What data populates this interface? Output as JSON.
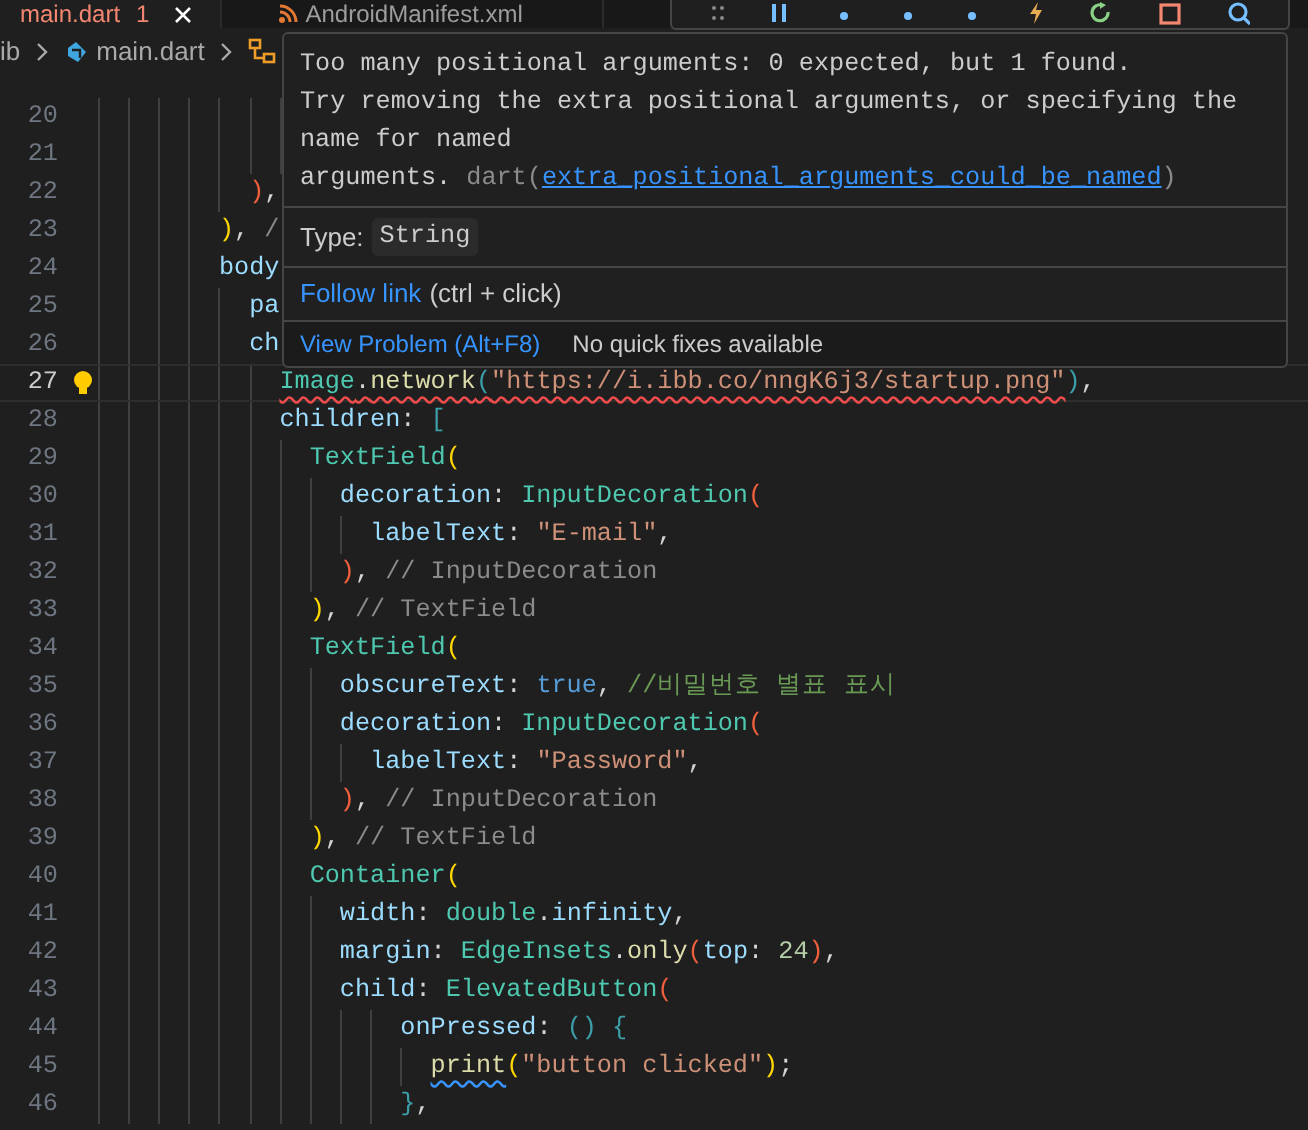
{
  "tabs": [
    {
      "label": "main.dart",
      "badge": "1",
      "kind": "dart",
      "selected": true
    },
    {
      "label": "AndroidManifest.xml",
      "kind": "xml",
      "selected": false
    }
  ],
  "debug_toolbar": [
    {
      "kind": "grip"
    },
    {
      "kind": "pause"
    },
    {
      "kind": "step_over"
    },
    {
      "kind": "step_into"
    },
    {
      "kind": "step_out"
    },
    {
      "kind": "hot_reload"
    },
    {
      "kind": "restart"
    },
    {
      "kind": "stop"
    },
    {
      "kind": "inspect"
    }
  ],
  "breadcrumbs": [
    {
      "kind": "folder",
      "label": "ib"
    },
    {
      "kind": "dart",
      "label": "main.dart"
    },
    {
      "kind": "symbol"
    }
  ],
  "lines": [
    {
      "number": "20",
      "current": false,
      "lightbulb": false
    },
    {
      "number": "21",
      "current": false,
      "lightbulb": false
    },
    {
      "number": "22",
      "current": false,
      "lightbulb": false,
      "tokens": [
        {
          "text": "          )",
          "kind": "b2"
        },
        {
          "text": ",",
          "kind": "p"
        }
      ]
    },
    {
      "number": "23",
      "current": false,
      "lightbulb": false,
      "tokens": [
        {
          "text": "        )",
          "kind": "b1"
        },
        {
          "text": ", ",
          "kind": "p"
        },
        {
          "text": "/",
          "kind": "h"
        }
      ]
    },
    {
      "number": "24",
      "current": false,
      "lightbulb": false,
      "tokens": [
        {
          "text": "        body",
          "kind": "v"
        }
      ]
    },
    {
      "number": "25",
      "current": false,
      "lightbulb": false,
      "tokens": [
        {
          "text": "          pa",
          "kind": "v"
        }
      ]
    },
    {
      "number": "26",
      "current": false,
      "lightbulb": false,
      "tokens": [
        {
          "text": "          ch",
          "kind": "v"
        }
      ]
    },
    {
      "number": "27",
      "current": true,
      "lightbulb": true,
      "tokens": [
        {
          "text": "            Image",
          "kind": "c",
          "squiggle": {
            "kind": "error"
          }
        },
        {
          "text": ".",
          "kind": "p",
          "squiggle": {
            "kind": "error"
          }
        },
        {
          "text": "network",
          "kind": "f",
          "squiggle": {
            "kind": "error"
          }
        },
        {
          "text": "(",
          "kind": "b3",
          "squiggle": {
            "kind": "error"
          }
        },
        {
          "text": "\"https://i.ibb.co/nngK6j3/startup.png\"",
          "kind": "s",
          "squiggle": {
            "kind": "error"
          }
        },
        {
          "text": ")",
          "kind": "b3"
        },
        {
          "text": ",",
          "kind": "p"
        }
      ]
    },
    {
      "number": "28",
      "current": false,
      "lightbulb": false,
      "tokens": [
        {
          "text": "            children",
          "kind": "v"
        },
        {
          "text": ": ",
          "kind": "p"
        },
        {
          "text": "[",
          "kind": "b3"
        }
      ]
    },
    {
      "number": "29",
      "current": false,
      "lightbulb": false,
      "tokens": [
        {
          "text": "              TextField",
          "kind": "c"
        },
        {
          "text": "(",
          "kind": "b1"
        }
      ]
    },
    {
      "number": "30",
      "current": false,
      "lightbulb": false,
      "tokens": [
        {
          "text": "                decoration",
          "kind": "v"
        },
        {
          "text": ": ",
          "kind": "p"
        },
        {
          "text": "InputDecoration",
          "kind": "c"
        },
        {
          "text": "(",
          "kind": "b2"
        }
      ]
    },
    {
      "number": "31",
      "current": false,
      "lightbulb": false,
      "tokens": [
        {
          "text": "                  labelText",
          "kind": "v"
        },
        {
          "text": ": ",
          "kind": "p"
        },
        {
          "text": "\"E-mail\"",
          "kind": "s"
        },
        {
          "text": ",",
          "kind": "p"
        }
      ]
    },
    {
      "number": "32",
      "current": false,
      "lightbulb": false,
      "tokens": [
        {
          "text": "                )",
          "kind": "b2"
        },
        {
          "text": ", ",
          "kind": "p"
        },
        {
          "text": "// InputDecoration",
          "kind": "h"
        }
      ]
    },
    {
      "number": "33",
      "current": false,
      "lightbulb": false,
      "tokens": [
        {
          "text": "              )",
          "kind": "b1"
        },
        {
          "text": ", ",
          "kind": "p"
        },
        {
          "text": "// TextField",
          "kind": "h"
        }
      ]
    },
    {
      "number": "34",
      "current": false,
      "lightbulb": false,
      "tokens": [
        {
          "text": "              TextField",
          "kind": "c"
        },
        {
          "text": "(",
          "kind": "b1"
        }
      ]
    },
    {
      "number": "35",
      "current": false,
      "lightbulb": false,
      "tokens": [
        {
          "text": "                obscureText",
          "kind": "v"
        },
        {
          "text": ": ",
          "kind": "p"
        },
        {
          "text": "true",
          "kind": "k"
        },
        {
          "text": ", ",
          "kind": "p"
        },
        {
          "text": "//비밀번호 별표 표시",
          "kind": "cm"
        }
      ]
    },
    {
      "number": "36",
      "current": false,
      "lightbulb": false,
      "tokens": [
        {
          "text": "                decoration",
          "kind": "v"
        },
        {
          "text": ": ",
          "kind": "p"
        },
        {
          "text": "InputDecoration",
          "kind": "c"
        },
        {
          "text": "(",
          "kind": "b2"
        }
      ]
    },
    {
      "number": "37",
      "current": false,
      "lightbulb": false,
      "tokens": [
        {
          "text": "                  labelText",
          "kind": "v"
        },
        {
          "text": ": ",
          "kind": "p"
        },
        {
          "text": "\"Password\"",
          "kind": "s"
        },
        {
          "text": ",",
          "kind": "p"
        }
      ]
    },
    {
      "number": "38",
      "current": false,
      "lightbulb": false,
      "tokens": [
        {
          "text": "                )",
          "kind": "b2"
        },
        {
          "text": ", ",
          "kind": "p"
        },
        {
          "text": "// InputDecoration",
          "kind": "h"
        }
      ]
    },
    {
      "number": "39",
      "current": false,
      "lightbulb": false,
      "tokens": [
        {
          "text": "              )",
          "kind": "b1"
        },
        {
          "text": ", ",
          "kind": "p"
        },
        {
          "text": "// TextField",
          "kind": "h"
        }
      ]
    },
    {
      "number": "40",
      "current": false,
      "lightbulb": false,
      "tokens": [
        {
          "text": "              Container",
          "kind": "c"
        },
        {
          "text": "(",
          "kind": "b1"
        }
      ]
    },
    {
      "number": "41",
      "current": false,
      "lightbulb": false,
      "tokens": [
        {
          "text": "                width",
          "kind": "v"
        },
        {
          "text": ": ",
          "kind": "p"
        },
        {
          "text": "double",
          "kind": "c"
        },
        {
          "text": ".",
          "kind": "p"
        },
        {
          "text": "infinity",
          "kind": "v"
        },
        {
          "text": ",",
          "kind": "p"
        }
      ]
    },
    {
      "number": "42",
      "current": false,
      "lightbulb": false,
      "tokens": [
        {
          "text": "                margin",
          "kind": "v"
        },
        {
          "text": ": ",
          "kind": "p"
        },
        {
          "text": "EdgeInsets",
          "kind": "c"
        },
        {
          "text": ".",
          "kind": "p"
        },
        {
          "text": "only",
          "kind": "f"
        },
        {
          "text": "(",
          "kind": "b2"
        },
        {
          "text": "top",
          "kind": "v"
        },
        {
          "text": ": ",
          "kind": "p"
        },
        {
          "text": "24",
          "kind": "n"
        },
        {
          "text": ")",
          "kind": "b2"
        },
        {
          "text": ",",
          "kind": "p"
        }
      ]
    },
    {
      "number": "43",
      "current": false,
      "lightbulb": false,
      "tokens": [
        {
          "text": "                child",
          "kind": "v"
        },
        {
          "text": ": ",
          "kind": "p"
        },
        {
          "text": "ElevatedButton",
          "kind": "c"
        },
        {
          "text": "(",
          "kind": "b2"
        }
      ]
    },
    {
      "number": "44",
      "current": false,
      "lightbulb": false,
      "tokens": [
        {
          "text": "                    onPressed",
          "kind": "v"
        },
        {
          "text": ": ",
          "kind": "p"
        },
        {
          "text": "() {",
          "kind": "b3"
        }
      ]
    },
    {
      "number": "45",
      "current": false,
      "lightbulb": false,
      "tokens": [
        {
          "text": "                      print",
          "kind": "f",
          "squiggle": {
            "kind": "warning"
          }
        },
        {
          "text": "(",
          "kind": "b1"
        },
        {
          "text": "\"button clicked\"",
          "kind": "s"
        },
        {
          "text": ")",
          "kind": "b1"
        },
        {
          "text": ";",
          "kind": "p"
        }
      ]
    },
    {
      "number": "46",
      "current": false,
      "lightbulb": false,
      "tokens": [
        {
          "text": "                    }",
          "kind": "b3"
        },
        {
          "text": ",",
          "kind": "p"
        }
      ]
    }
  ],
  "hover": {
    "message_lines": [
      "Too many positional arguments: 0 expected, but 1 found.",
      "Try removing the extra positional arguments, or specifying the",
      "name for named",
      "arguments."
    ],
    "source": "dart(",
    "code": "extra_positional_arguments_could_be_named",
    "source_end": ")",
    "type_label": "Type:",
    "type_value": "String",
    "follow_link": "Follow link",
    "follow_hint": "(ctrl + click)",
    "actions": [
      {
        "kind": "link",
        "label": "View Problem (Alt+F8)"
      },
      {
        "kind": "text",
        "label": "No quick fixes available"
      }
    ]
  }
}
